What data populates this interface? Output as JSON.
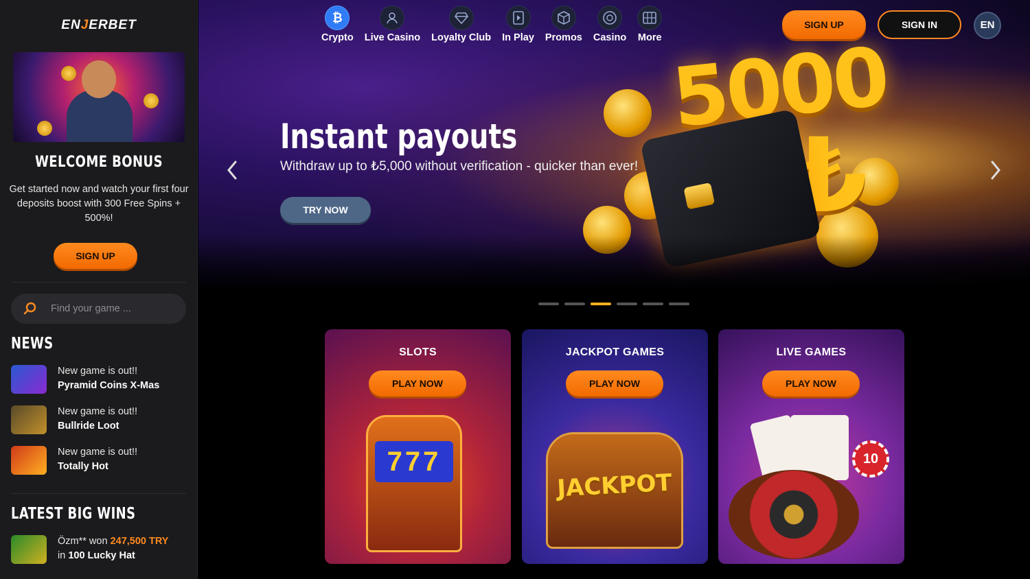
{
  "sidebar": {
    "logo": {
      "prefix": "EN",
      "highlight": "J",
      "suffix": "ERBET"
    },
    "welcome_title": "WELCOME BONUS",
    "welcome_text": "Get started now and watch your first four deposits boost with 300 Free Spins + 500%!",
    "signup_label": "SIGN UP",
    "search_placeholder": "Find your game ...",
    "news_title": "NEWS",
    "news": [
      {
        "line1": "New game is out!!",
        "line2": "Pyramid Coins X-Mas"
      },
      {
        "line1": "New game is out!!",
        "line2": "Bullride Loot"
      },
      {
        "line1": "New game is out!!",
        "line2": "Totally Hot"
      }
    ],
    "wins_title": "LATEST BIG WINS",
    "wins": [
      {
        "user": "Özm** won",
        "amount": "247,500 TRY",
        "prefix": "in",
        "game": "100 Lucky Hat"
      }
    ]
  },
  "nav": {
    "items": [
      {
        "label": "Crypto",
        "icon": "bitcoin-icon"
      },
      {
        "label": "Live Casino",
        "icon": "dealer-icon"
      },
      {
        "label": "Loyalty Club",
        "icon": "diamond-icon"
      },
      {
        "label": "In Play",
        "icon": "play-screen-icon"
      },
      {
        "label": "Promos",
        "icon": "gift-box-icon"
      },
      {
        "label": "Casino",
        "icon": "chip-icon"
      },
      {
        "label": "More",
        "icon": "grid-icon"
      }
    ],
    "active_index": 0,
    "signup_label": "SIGN UP",
    "signin_label": "SIGN IN",
    "lang": "EN"
  },
  "hero": {
    "title": "Instant payouts",
    "subtitle": "Withdraw up to ₺5,000 without verification - quicker than ever!",
    "cta": "TRY NOW",
    "art_number": "5000",
    "art_currency": "₺",
    "prev_icon": "chevron-left-icon",
    "next_icon": "chevron-right-icon",
    "slides_count": 6,
    "active_slide": 2
  },
  "categories": [
    {
      "title": "SLOTS",
      "cta": "PLAY NOW",
      "art_text": "777"
    },
    {
      "title": "JACKPOT GAMES",
      "cta": "PLAY NOW",
      "art_text": "JACKPOT"
    },
    {
      "title": "LIVE GAMES",
      "cta": "PLAY NOW",
      "art_text": "10"
    }
  ],
  "colors": {
    "accent": "#ff8a1f",
    "sidebar_bg": "#1b1b1d",
    "nav_active": "#2f7cf6",
    "dot_active": "#ffb01f"
  }
}
